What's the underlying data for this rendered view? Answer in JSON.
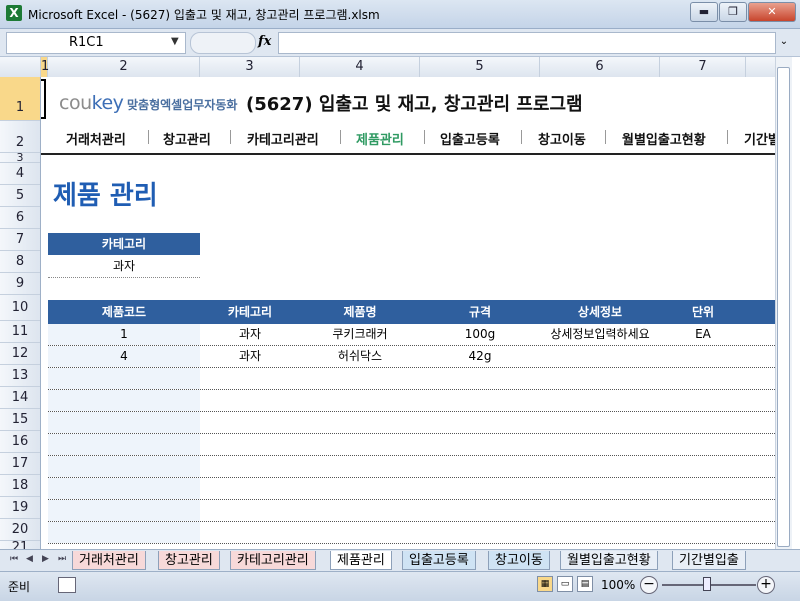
{
  "window": {
    "title": "Microsoft Excel - (5627) 입출고 및 재고, 창고관리 프로그램.xlsm",
    "app_icon": "X"
  },
  "window_buttons": {
    "minimize": "▬",
    "restore": "❐",
    "close": "✕"
  },
  "formula_bar": {
    "name_box": "R1C1",
    "fx": "fx",
    "formula": ""
  },
  "columns": [
    "1",
    "2",
    "3",
    "4",
    "5",
    "6",
    "7"
  ],
  "rows": [
    "1",
    "2",
    "3",
    "4",
    "5",
    "6",
    "7",
    "8",
    "9",
    "10",
    "11",
    "12",
    "13",
    "14",
    "15",
    "16",
    "17",
    "18",
    "19",
    "20",
    "21"
  ],
  "brand": {
    "coukey_a": "cou",
    "coukey_b": "key",
    "tagline": "맞춤형엑셀업무자동화"
  },
  "page_title": "(5627) 입출고 및 재고, 창고관리 프로그램",
  "menu": [
    "거래처관리",
    "창고관리",
    "카테고리관리",
    "제품관리",
    "입출고등록",
    "창고이동",
    "월별입출고현황",
    "기간별"
  ],
  "menu_active": "제품관리",
  "section_title": "제품 관리",
  "category_filter": {
    "label": "카테고리",
    "value": "과자"
  },
  "table": {
    "headers": [
      "제품코드",
      "카테고리",
      "제품명",
      "규격",
      "상세정보",
      "단위"
    ],
    "rows": [
      [
        "1",
        "과자",
        "쿠키크래커",
        "100g",
        "상세정보입력하세요",
        "EA"
      ],
      [
        "4",
        "과자",
        "허쉬닥스",
        "42g",
        "",
        ""
      ]
    ]
  },
  "sheet_tabs": [
    "거래처관리",
    "창고관리",
    "카테고리관리",
    "제품관리",
    "입출고등록",
    "창고이동",
    "월별입출고현황",
    "기간별입출"
  ],
  "active_sheet": "제품관리",
  "status": {
    "ready": "준비",
    "zoom": "100%"
  }
}
